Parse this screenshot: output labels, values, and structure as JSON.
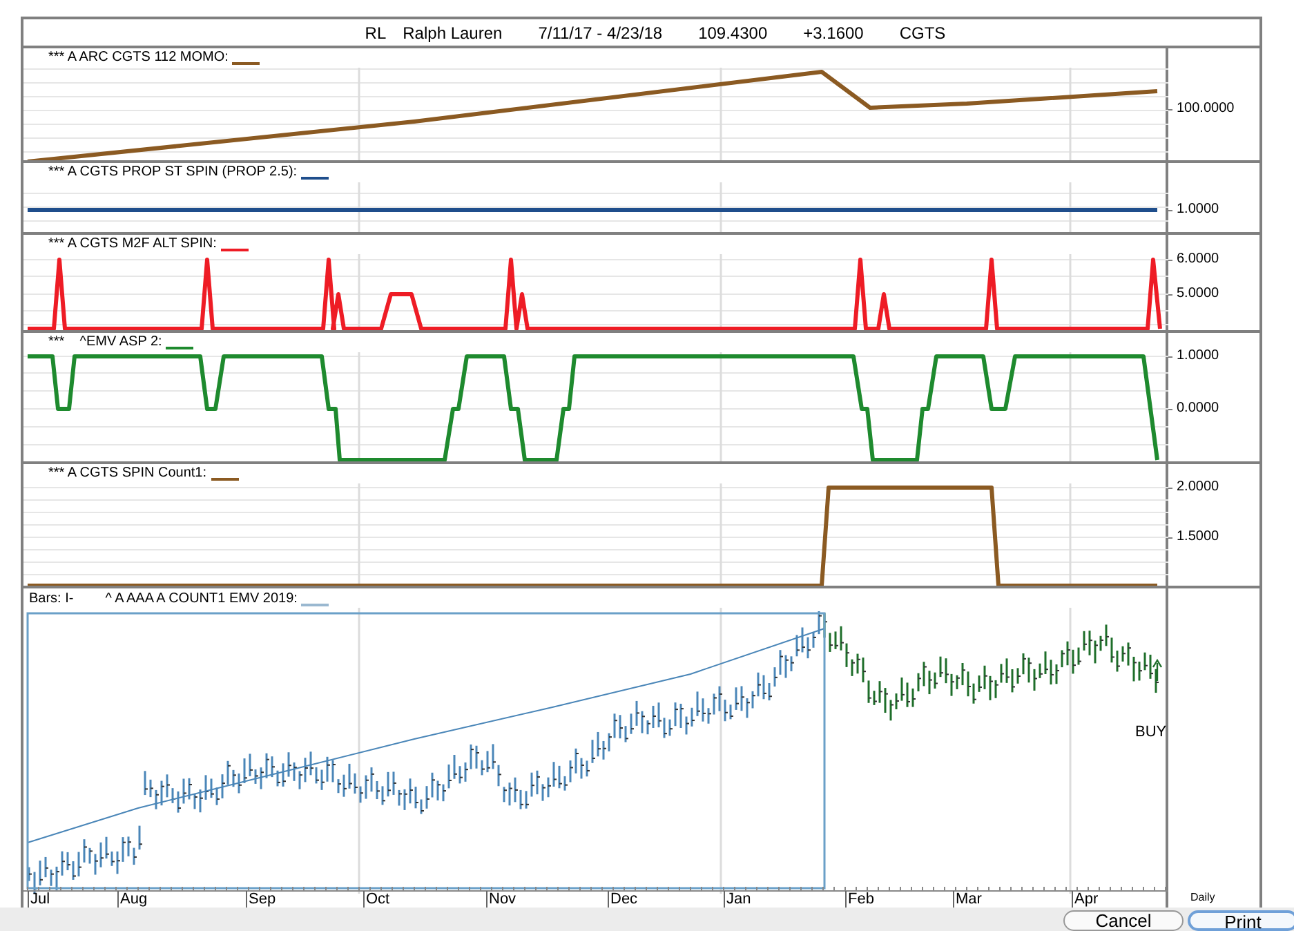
{
  "header": {
    "symbol": "RL",
    "name": "Ralph Lauren",
    "date_range": "7/11/17 - 4/23/18",
    "price": "109.4300",
    "change": "+3.1600",
    "study": "CGTS"
  },
  "panels": [
    {
      "label": "*** A ARC CGTS 112 MOMO:",
      "color": "#8b5a22",
      "axis_labels": [
        "100.0000"
      ]
    },
    {
      "label": "*** A CGTS PROP ST SPIN (PROP 2.5):",
      "color": "#1f4e8c",
      "axis_labels": [
        "1.0000"
      ]
    },
    {
      "label": "*** A CGTS M2F ALT SPIN:",
      "color": "#ee1c25",
      "axis_labels": [
        "6.0000",
        "5.0000"
      ]
    },
    {
      "label": "***    ^EMV ASP 2:",
      "color": "#1e8a2e",
      "axis_labels": [
        "1.0000",
        "0.0000"
      ]
    },
    {
      "label": "*** A CGTS SPIN Count1:",
      "color": "#8b5a22",
      "axis_labels": [
        "2.0000",
        "1.5000"
      ]
    }
  ],
  "price_panel": {
    "bars_label": "Bars: I-",
    "study_label": "^ A AAA A COUNT1 EMV 2019:",
    "signal": "BUY"
  },
  "x_axis": [
    "Jul",
    "Aug",
    "Sep",
    "Oct",
    "Nov",
    "Dec",
    "Jan",
    "Feb",
    "Mar",
    "Apr"
  ],
  "period": "Daily",
  "buttons": [
    {
      "label": "Cancel",
      "default": false
    },
    {
      "label": "Print",
      "default": true
    }
  ]
}
